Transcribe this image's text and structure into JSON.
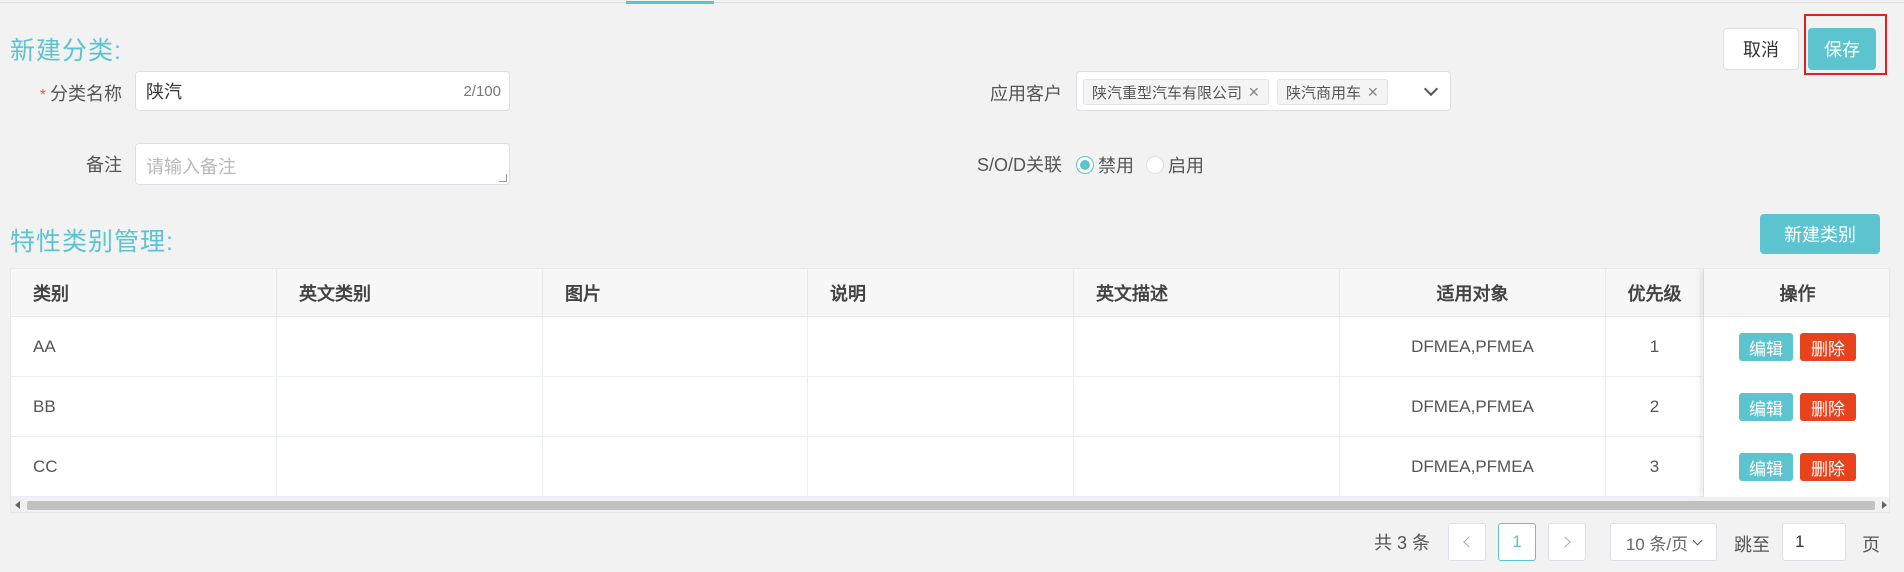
{
  "form": {
    "title": "新建分类:",
    "category_name_label": "分类名称",
    "required_mark": "*",
    "category_name_value": "陕汽",
    "category_name_counter": "2/100",
    "remark_label": "备注",
    "remark_placeholder": "请输入备注",
    "customer_label": "应用客户",
    "customer_tags": [
      "陕汽重型汽车有限公司",
      "陕汽商用车"
    ],
    "sod_label": "S/O/D关联",
    "sod_options": [
      {
        "label": "禁用",
        "selected": true
      },
      {
        "label": "启用",
        "selected": false
      }
    ],
    "cancel_label": "取消",
    "save_label": "保存"
  },
  "characteristics": {
    "title": "特性类别管理:",
    "new_button_label": "新建类别",
    "columns": [
      "类别",
      "英文类别",
      "图片",
      "说明",
      "英文描述",
      "适用对象",
      "优先级",
      "操作"
    ],
    "rows": [
      {
        "category": "AA",
        "en_category": "",
        "image": "",
        "desc": "",
        "en_desc": "",
        "target": "DFMEA,PFMEA",
        "priority": "1"
      },
      {
        "category": "BB",
        "en_category": "",
        "image": "",
        "desc": "",
        "en_desc": "",
        "target": "DFMEA,PFMEA",
        "priority": "2"
      },
      {
        "category": "CC",
        "en_category": "",
        "image": "",
        "desc": "",
        "en_desc": "",
        "target": "DFMEA,PFMEA",
        "priority": "3"
      }
    ],
    "edit_label": "编辑",
    "delete_label": "删除"
  },
  "pagination": {
    "total_text": "共 3 条",
    "current_page": "1",
    "page_size": "10 条/页",
    "goto_label": "跳至",
    "goto_value": "1",
    "page_suffix": "页"
  },
  "colors": {
    "accent": "#5bc4cf",
    "danger": "#e8431c",
    "highlight": "#e22020"
  }
}
